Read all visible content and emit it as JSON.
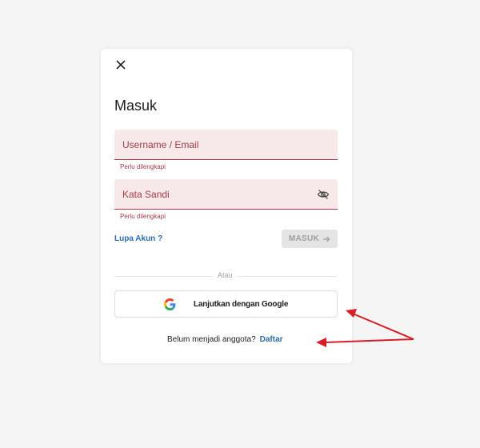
{
  "modal": {
    "title": "Masuk",
    "close_icon": "close-icon",
    "username": {
      "placeholder": "Username / Email",
      "value": "",
      "error": "Perlu dilengkapi"
    },
    "password": {
      "placeholder": "Kata Sandi",
      "value": "",
      "error": "Perlu dilengkapi",
      "toggle_icon": "eye-slash-icon"
    },
    "forgot_label": "Lupa Akun ?",
    "submit_label": "MASUK",
    "submit_icon": "arrow-right-icon",
    "divider_label": "Atau",
    "google_label": "Lanjutkan dengan Google",
    "google_icon": "google-icon",
    "register_prompt": "Belum menjadi anggota?",
    "register_label": "Daftar"
  },
  "colors": {
    "error": "#a33a48",
    "field_bg": "#f7e9ea",
    "link": "#2b6cb0",
    "annotation_arrow": "#d81f26"
  }
}
